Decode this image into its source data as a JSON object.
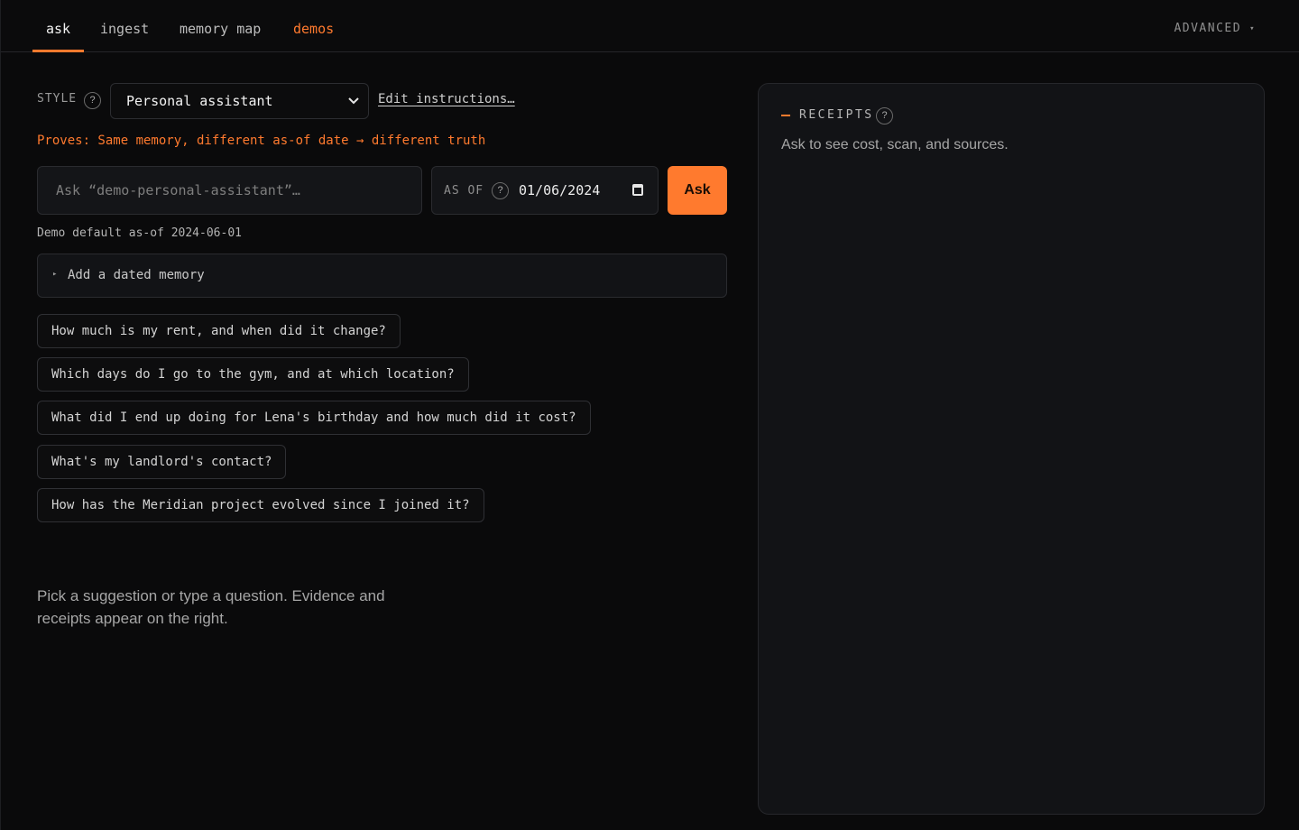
{
  "nav": {
    "tabs": [
      {
        "label": "ask"
      },
      {
        "label": "ingest"
      },
      {
        "label": "memory map"
      },
      {
        "label": "demos"
      }
    ],
    "advanced_label": "ADVANCED",
    "advanced_caret": "▾"
  },
  "style": {
    "label": "STYLE",
    "help": "?",
    "selected": "Personal assistant",
    "chevron": "⌄",
    "edit_link": "Edit instructions…"
  },
  "proves_text": "Proves: Same memory, different as-of date → different truth",
  "ask": {
    "placeholder": "Ask “demo-personal-assistant”…",
    "value": "",
    "asof_label": "AS OF",
    "asof_help": "?",
    "asof_value": "01/06/2024",
    "button_label": "Ask"
  },
  "demo_default": "Demo default as-of 2024-06-01",
  "add_memory": {
    "marker": "▸",
    "label": "Add a dated memory"
  },
  "suggestions": [
    "How much is my rent, and when did it change?",
    "Which days do I go to the gym, and at which location?",
    "What did I end up doing for Lena's birthday and how much did it cost?",
    "What's my landlord's contact?",
    "How has the Meridian project evolved since I joined it?"
  ],
  "hint": "Pick a suggestion or type a question. Evidence and receipts appear on the right.",
  "receipts": {
    "title": "RECEIPTS",
    "help": "?",
    "message": "Ask to see cost, scan, and sources."
  },
  "colors": {
    "accent": "#ff7a2e",
    "background": "#0a0a0b",
    "panel": "#121316"
  }
}
